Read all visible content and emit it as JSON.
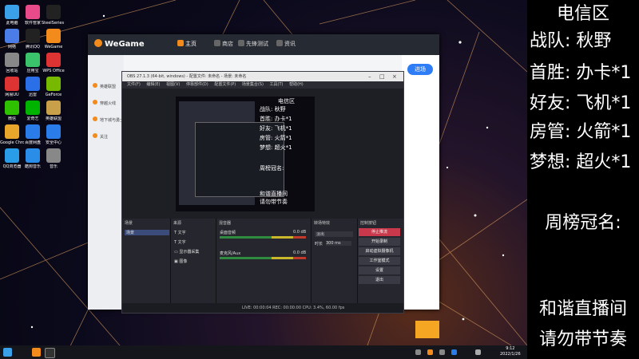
{
  "desktop": {
    "icons": [
      {
        "label": "此电脑",
        "color": "#3aa0e8"
      },
      {
        "label": "软件管家",
        "color": "#e84a8a"
      },
      {
        "label": "SteelSeries GG",
        "color": "#222"
      },
      {
        "label": "网络",
        "color": "#4a7de8"
      },
      {
        "label": "腾讯QQ",
        "color": "#222"
      },
      {
        "label": "WeGame",
        "color": "#f28b1c"
      },
      {
        "label": "回收站",
        "color": "#888"
      },
      {
        "label": "应用宝",
        "color": "#3ac36b"
      },
      {
        "label": "WPS Office",
        "color": "#d33"
      },
      {
        "label": "网易UU",
        "color": "#d33"
      },
      {
        "label": "迅雷",
        "color": "#2a6ee8"
      },
      {
        "label": "GeForce",
        "color": "#76b900"
      },
      {
        "label": "微信",
        "color": "#2dc100"
      },
      {
        "label": "爱奇艺",
        "color": "#00b300"
      },
      {
        "label": "英雄联盟",
        "color": "#c8a04a"
      },
      {
        "label": "Google Chrome",
        "color": "#e8a62a"
      },
      {
        "label": "百度网盘",
        "color": "#2a7de8"
      },
      {
        "label": "安全中心",
        "color": "#2a7de8"
      },
      {
        "label": "QQ浏览器",
        "color": "#2a9de8"
      },
      {
        "label": "酷狗音乐",
        "color": "#2a8de8"
      },
      {
        "label": "音乐",
        "color": "#888"
      }
    ]
  },
  "wegame": {
    "title": "WeGame",
    "tabs": [
      "主页",
      "商店",
      "先锋测试",
      "资讯"
    ],
    "sidebar": [
      "英雄联盟",
      "穿越火线",
      "地下城与勇士",
      "关注"
    ],
    "join_button": "进场"
  },
  "obs": {
    "title": "OBS 27.1.3 (64-bit, windows) - 配置文件: 未命名 - 场景: 未命名",
    "menu": [
      "文件(F)",
      "编辑(E)",
      "视图(V)",
      "停靠部件(D)",
      "配置文件(P)",
      "场景集合(S)",
      "工具(T)",
      "帮助(H)"
    ],
    "preview_text": [
      "电信区",
      "战队: 秋野",
      "首胜: 办卡*1",
      "好友: 飞机*1",
      "房管: 火箭*1",
      "梦想: 超火*1",
      "周榜冠名:",
      "和谐直播间",
      "请勿带节奏"
    ],
    "docks": {
      "scenes_title": "场景",
      "scene_items": [
        "场景"
      ],
      "sources_title": "来源",
      "sources": [
        "文字",
        "文字",
        "显示器采集",
        "图像"
      ],
      "mixer_title": "混音器",
      "mixer": [
        {
          "name": "桌面音频",
          "db": "0.0 dB"
        },
        {
          "name": "麦克风/Aux",
          "db": "0.0 dB"
        }
      ],
      "transition_title": "转场特效",
      "transition_value": "淡出",
      "duration_label": "时长",
      "duration_value": "300 ms",
      "controls_title": "控制按钮",
      "controls": [
        "停止推流",
        "开始录制",
        "启动虚拟摄像机",
        "工作室模式",
        "设置",
        "退出"
      ]
    },
    "status": "LIVE: 00:00:04   REC: 00:00:00   CPU: 3.4%, 60.00 fps"
  },
  "overlay": {
    "lines": [
      "电信区",
      "战队:   秋野",
      "首胜: 办卡*1",
      "好友: 飞机*1",
      "房管: 火箭*1",
      "梦想: 超火*1",
      "周榜冠名:",
      "和谐直播间",
      "请勿带节奏"
    ]
  },
  "taskbar": {
    "time": "9:12",
    "date": "2022/1/26"
  }
}
